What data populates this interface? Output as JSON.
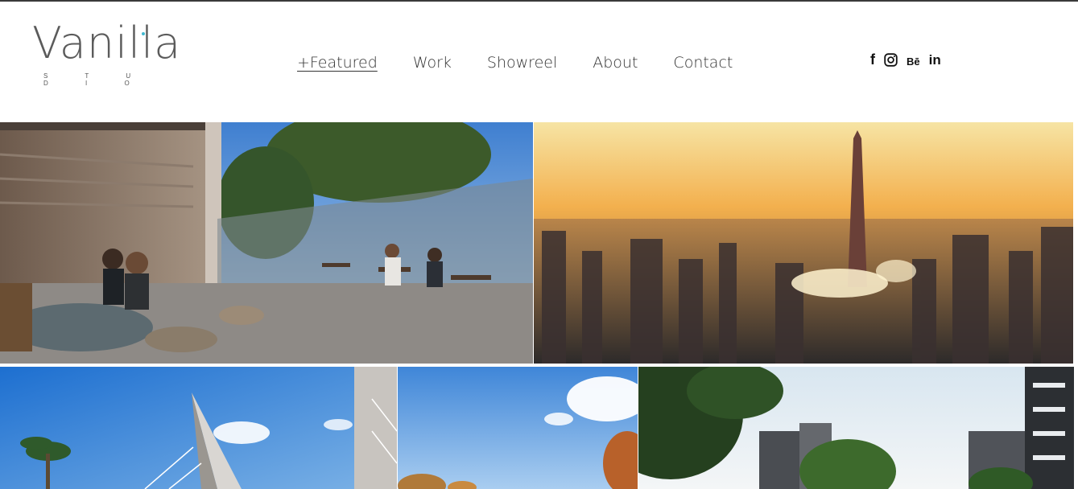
{
  "brand": {
    "name": "Vanilla",
    "tagline": "S T U D I O"
  },
  "nav": {
    "items": [
      {
        "label": "+Featured",
        "active": true
      },
      {
        "label": "Work"
      },
      {
        "label": "Showreel"
      },
      {
        "label": "About"
      },
      {
        "label": "Contact"
      }
    ]
  },
  "social": {
    "facebook": "f",
    "instagram": "instagram-icon",
    "behance": "Bē",
    "linkedin": "in"
  },
  "gallery": {
    "tiles": [
      {
        "subject": "outdoor-cafe-terrace"
      },
      {
        "subject": "city-skyline-sunset-obelisk"
      },
      {
        "subject": "cable-stayed-bridge-pylon"
      },
      {
        "subject": "blue-sky-autumn-trees"
      },
      {
        "subject": "residential-buildings-trees"
      }
    ]
  },
  "colors": {
    "accent": "#40b8d0",
    "text": "#333333",
    "topline": "#3a3a3a"
  }
}
